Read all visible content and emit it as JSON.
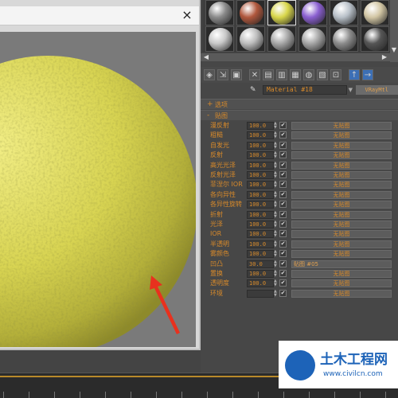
{
  "preview": {
    "close_icon": "×",
    "sphere_color": "#e2de62"
  },
  "slots": {
    "colors": [
      "#8a8a8a",
      "#b0573c",
      "#d8d64a",
      "#8a5fd0",
      "#b8c0c8",
      "#d2c6a4",
      "#c8c8c8",
      "#bdbdbd",
      "#a8a8a8",
      "#a6a6a6",
      "#8c8c8c",
      "#555555"
    ]
  },
  "material": {
    "name": "Material #18",
    "type": "VRayMtl"
  },
  "rollouts": {
    "options": "选项",
    "maps": "贴图"
  },
  "map_rows": [
    {
      "name": "漫反射",
      "value": "100.0",
      "button": "无贴图"
    },
    {
      "name": "粗糙",
      "value": "100.0",
      "button": "无贴图"
    },
    {
      "name": "自发光",
      "value": "100.0",
      "button": "无贴图"
    },
    {
      "name": "反射",
      "value": "100.0",
      "button": "无贴图"
    },
    {
      "name": "高光光泽",
      "value": "100.0",
      "button": "无贴图"
    },
    {
      "name": "反射光泽",
      "value": "100.0",
      "button": "无贴图"
    },
    {
      "name": "菲涅尔 IOR",
      "value": "100.0",
      "button": "无贴图"
    },
    {
      "name": "各向异性",
      "value": "100.0",
      "button": "无贴图"
    },
    {
      "name": "各异性旋转",
      "value": "100.0",
      "button": "无贴图"
    },
    {
      "name": "折射",
      "value": "100.0",
      "button": "无贴图"
    },
    {
      "name": "光泽",
      "value": "100.0",
      "button": "无贴图"
    },
    {
      "name": "IOR",
      "value": "100.0",
      "button": "无贴图"
    },
    {
      "name": "半透明",
      "value": "100.0",
      "button": "无贴图"
    },
    {
      "name": "雾颜色",
      "value": "100.0",
      "button": "无贴图"
    },
    {
      "name": "凹凸",
      "value": "30.0",
      "button": "贴图 #05"
    },
    {
      "name": "置换",
      "value": "100.0",
      "button": "无贴图"
    },
    {
      "name": "透明度",
      "value": "100.0",
      "button": "无贴图"
    },
    {
      "name": "环境",
      "value": "",
      "button": "无贴图"
    }
  ],
  "colors": {
    "label": "#d88a2a",
    "arrow": "#e8311e"
  },
  "logo": {
    "title": "土木工程网",
    "url": "www.civilcn.com"
  }
}
